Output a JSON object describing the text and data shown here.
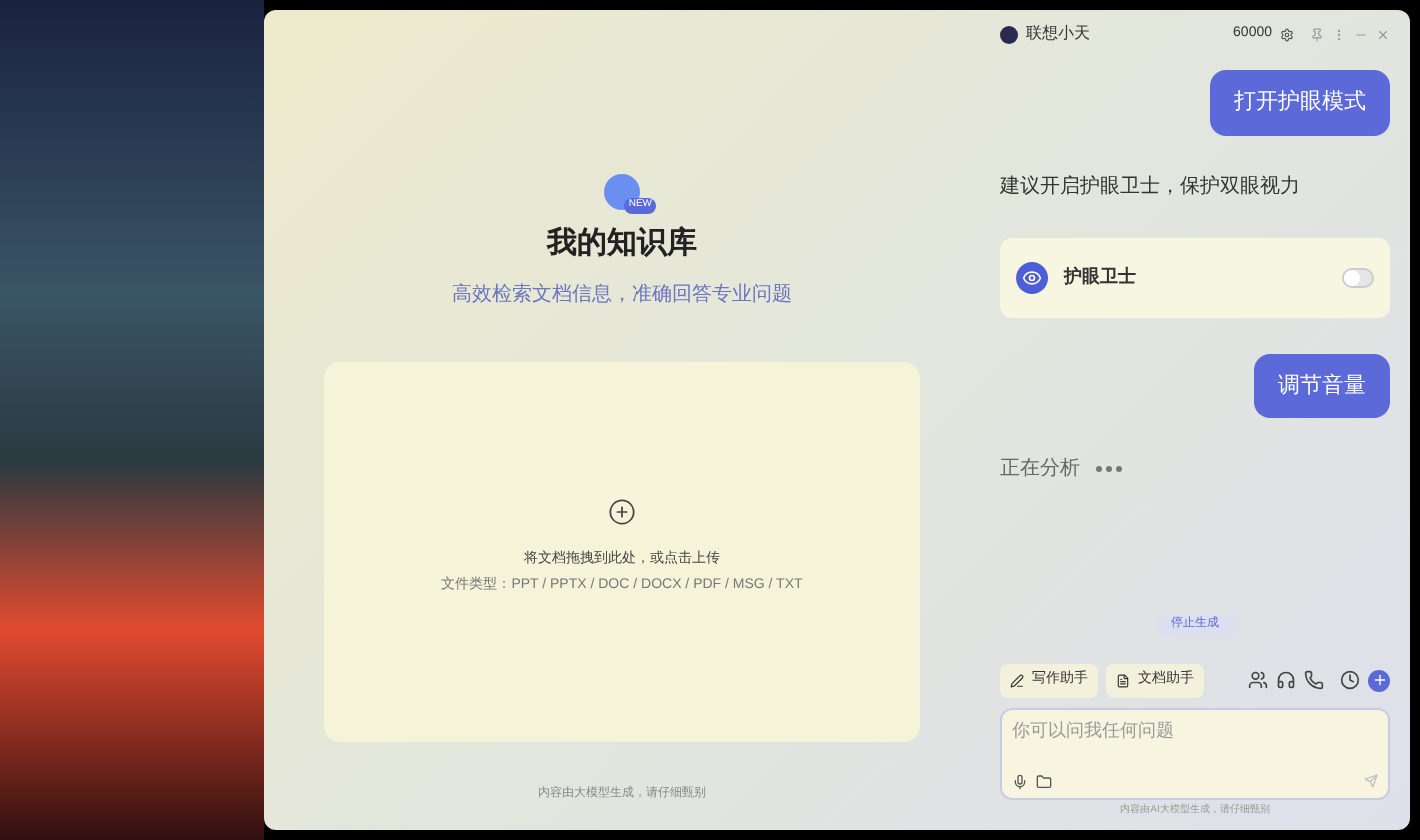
{
  "app": {
    "title": "联想小天",
    "points": "60000"
  },
  "knowledge": {
    "badge": "NEW",
    "title": "我的知识库",
    "subtitle": "高效检索文档信息，准确回答专业问题",
    "upload_hint": "将文档拖拽到此处，或点击上传",
    "file_types": "文件类型：PPT / PPTX / DOC / DOCX / PDF / MSG / TXT",
    "footer": "内容由大模型生成，请仔细甄别"
  },
  "chat": [
    {
      "kind": "user",
      "text": "打开护眼模式"
    },
    {
      "kind": "bot",
      "text": "建议开启护眼卫士，保护双眼视力"
    },
    {
      "kind": "toggle",
      "label": "护眼卫士",
      "on": false
    },
    {
      "kind": "user",
      "text": "调节音量"
    },
    {
      "kind": "status",
      "text": "正在分析"
    }
  ],
  "stop_button": "停止生成",
  "tools": [
    "写作助手",
    "文档助手"
  ],
  "input": {
    "placeholder": "你可以问我任何问题"
  },
  "disclaimer": "内容由AI大模型生成，请仔细甄别"
}
